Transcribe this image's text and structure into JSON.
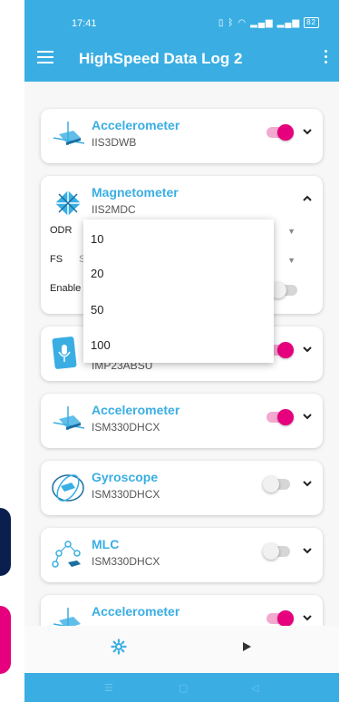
{
  "status": {
    "time": "17:41",
    "battery": "82"
  },
  "appbar": {
    "title": "HighSpeed Data Log 2"
  },
  "sensors": [
    {
      "title": "Accelerometer",
      "subtitle": "IIS3DWB",
      "enabled": true,
      "icon": "accelerometer-icon"
    },
    {
      "title": "Magnetometer",
      "subtitle": "IIS2MDC",
      "expanded": true,
      "icon": "magnetometer-icon",
      "rows": {
        "odr_label": "ODR",
        "fs_label": "FS",
        "fs_peek": "S",
        "enable_label": "Enable"
      }
    },
    {
      "title": "",
      "subtitle": "IMP23ABSU",
      "enabled": true,
      "icon": "microphone-icon"
    },
    {
      "title": "Accelerometer",
      "subtitle": "ISM330DHCX",
      "enabled": true,
      "icon": "accelerometer-icon"
    },
    {
      "title": "Gyroscope",
      "subtitle": "ISM330DHCX",
      "enabled": false,
      "icon": "gyroscope-icon"
    },
    {
      "title": "MLC",
      "subtitle": "ISM330DHCX",
      "enabled": false,
      "icon": "mlc-icon"
    },
    {
      "title": "Accelerometer",
      "subtitle": "",
      "enabled": true,
      "icon": "accelerometer-icon"
    }
  ],
  "dropdown": {
    "options": [
      "10",
      "20",
      "50",
      "100"
    ]
  },
  "colors": {
    "accent": "#3aaee3",
    "toggle_on": "#e6007e"
  }
}
